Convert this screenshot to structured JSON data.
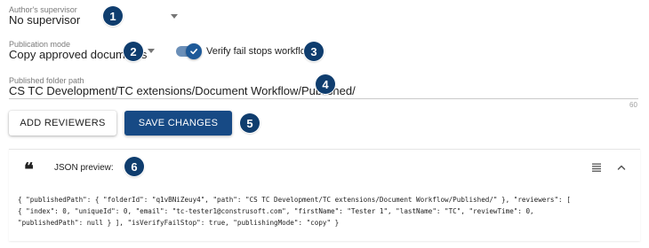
{
  "supervisor": {
    "label": "Author's supervisor",
    "value": "No supervisor"
  },
  "publication_mode": {
    "label": "Publication mode",
    "value": "Copy approved documents"
  },
  "verify_toggle": {
    "label": "Verify fail stops workflow",
    "checked": true
  },
  "published_path": {
    "label": "Published folder path",
    "value": "CS TC Development/TC extensions/Document Workflow/Published/",
    "counter": "60"
  },
  "buttons": {
    "add_reviewers": "ADD REVIEWERS",
    "save_changes": "SAVE CHANGES"
  },
  "json_preview": {
    "label": "JSON preview:",
    "lines": [
      "{ \"publishedPath\": { \"folderId\": \"q1vBNiZeuy4\", \"path\": \"CS TC Development/TC extensions/Document Workflow/Published/\" }, \"reviewers\": [",
      "{ \"index\": 0, \"uniqueId\": 0, \"email\": \"tc-tester1@construsoft.com\", \"firstName\": \"Tester 1\", \"lastName\": \"TC\", \"reviewTime\": 0,",
      "\"publishedPath\": null } ], \"isVerifyFailStop\": true, \"publishingMode\": \"copy\" }"
    ]
  },
  "callouts": [
    "1",
    "2",
    "3",
    "4",
    "5",
    "6"
  ],
  "icons": {
    "quote": "format-quote-icon",
    "menu": "hamburger-menu-icon",
    "collapse": "chevron-up-icon",
    "check": "check-icon"
  },
  "colors": {
    "primary": "#174a85",
    "badge": "#0f3d6e",
    "toggle_track": "#6b8fb8"
  }
}
